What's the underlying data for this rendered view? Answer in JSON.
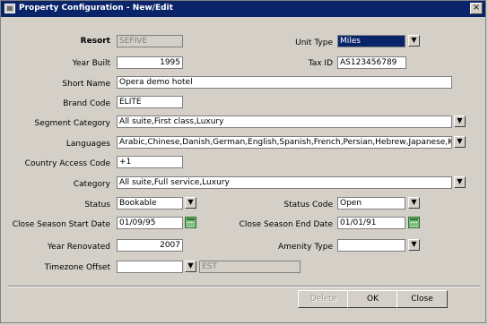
{
  "window": {
    "title": "Property Configuration - New/Edit",
    "close_glyph": "×"
  },
  "form": {
    "resort_label": "Resort",
    "resort_value": "SEFIVE",
    "unit_type_label": "Unit Type",
    "unit_type_value": "Miles",
    "year_built_label": "Year Built",
    "year_built_value": "1995",
    "tax_id_label": "Tax ID",
    "tax_id_value": "AS123456789",
    "short_name_label": "Short Name",
    "short_name_value": "Opera demo hotel",
    "brand_code_label": "Brand Code",
    "brand_code_value": "ELITE",
    "segment_category_label": "Segment Category",
    "segment_category_value": "All suite,First class,Luxury",
    "languages_label": "Languages",
    "languages_value": "Arabic,Chinese,Danish,German,English,Spanish,French,Persian,Hebrew,Japanese,Korea",
    "country_access_code_label": "Country Access Code",
    "country_access_code_value": "+1",
    "category_label": "Category",
    "category_value": "All suite,Full service,Luxury",
    "status_label": "Status",
    "status_value": "Bookable",
    "status_code_label": "Status Code",
    "status_code_value": "Open",
    "close_season_start_label": "Close Season Start Date",
    "close_season_start_value": "01/09/95",
    "close_season_end_label": "Close Season End Date",
    "close_season_end_value": "01/01/91",
    "year_renovated_label": "Year Renovated",
    "year_renovated_value": "2007",
    "amenity_type_label": "Amenity Type",
    "amenity_type_value": "",
    "timezone_offset_label": "Timezone Offset",
    "timezone_offset_value": "",
    "timezone_name_value": "EST"
  },
  "buttons": {
    "delete": "Delete",
    "ok": "OK",
    "close": "Close"
  },
  "icons": {
    "dropdown": "dropdown-arrow-icon",
    "calendar": "calendar-icon"
  }
}
